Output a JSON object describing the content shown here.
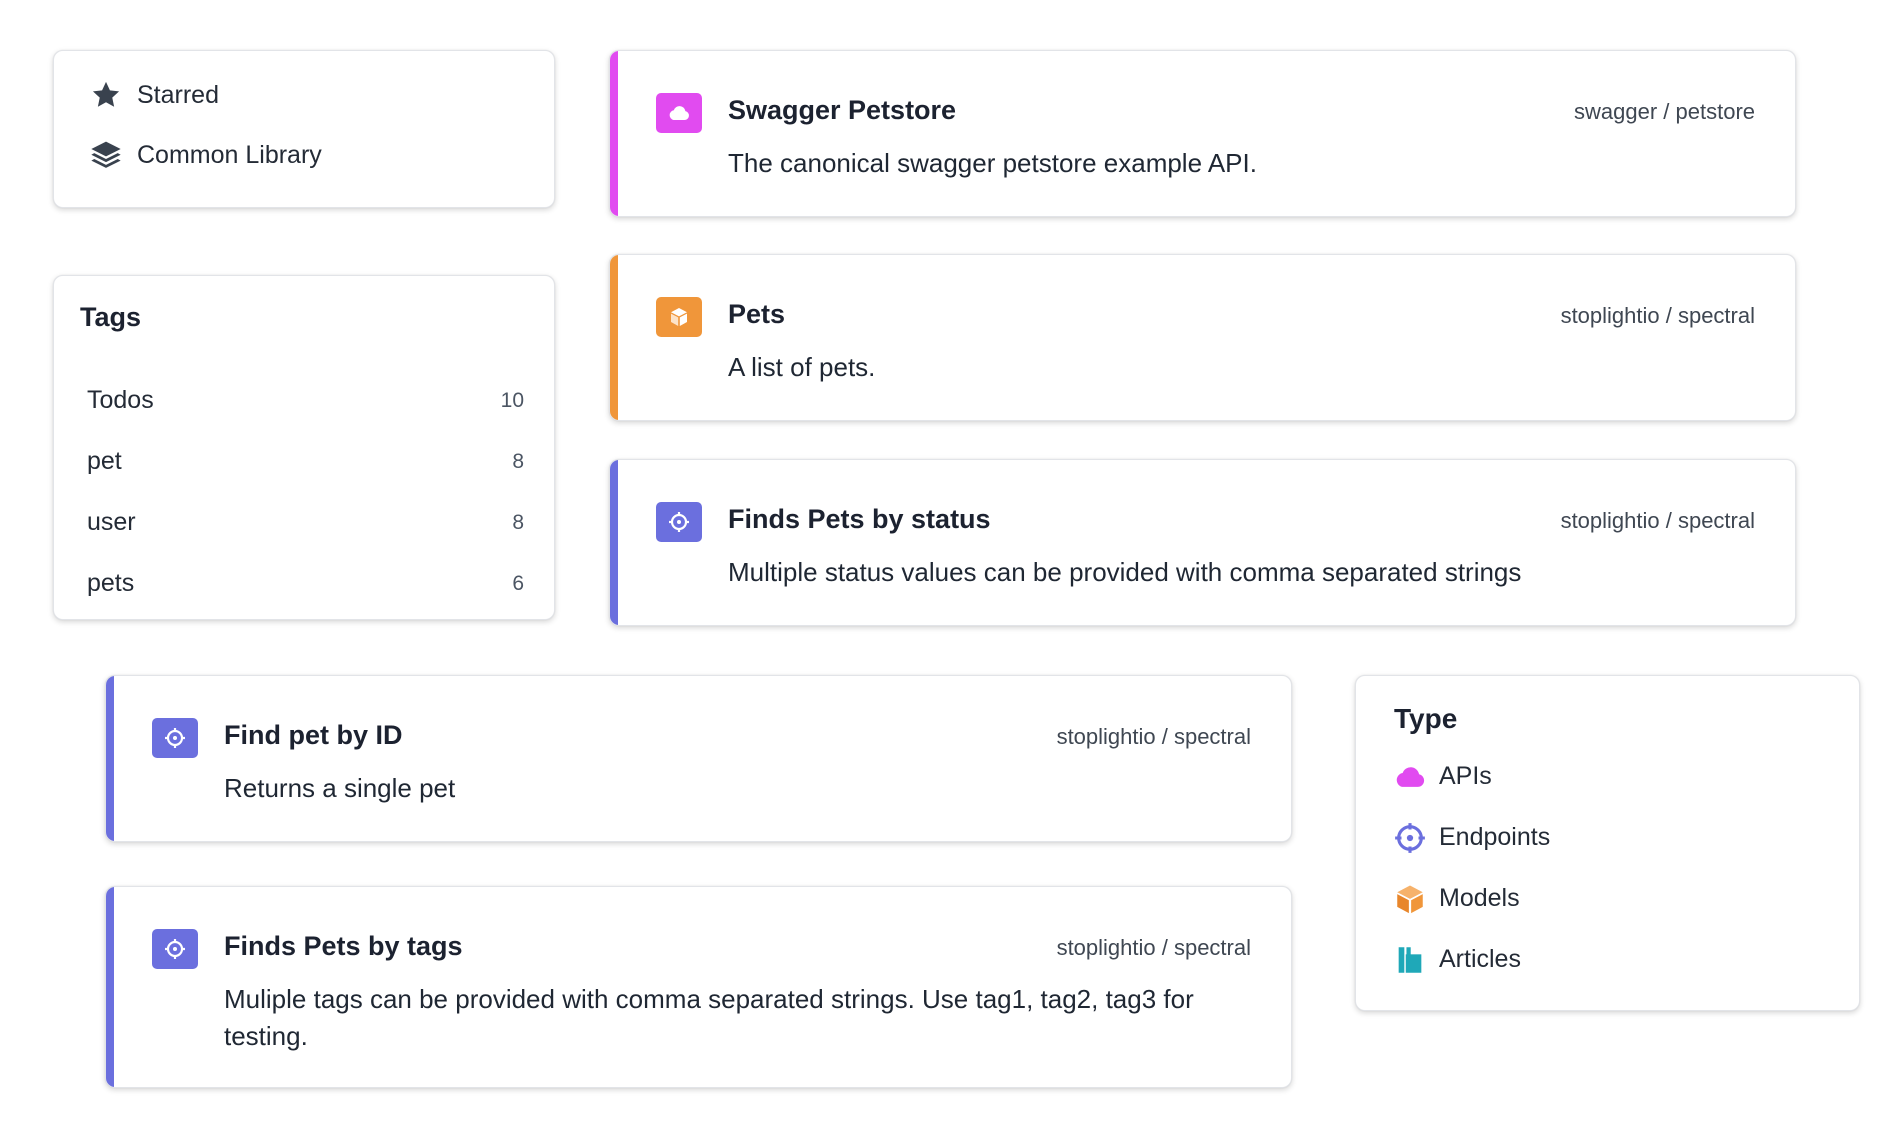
{
  "nav": {
    "items": [
      {
        "label": "Starred",
        "icon": "star-icon"
      },
      {
        "label": "Common Library",
        "icon": "layers-icon"
      }
    ]
  },
  "tags": {
    "title": "Tags",
    "items": [
      {
        "label": "Todos",
        "count": "10"
      },
      {
        "label": "pet",
        "count": "8"
      },
      {
        "label": "user",
        "count": "8"
      },
      {
        "label": "pets",
        "count": "6"
      }
    ]
  },
  "results": [
    {
      "title": "Swagger Petstore",
      "repo": "swagger / petstore",
      "description": "The canonical swagger petstore example API.",
      "kind": "api",
      "icon": "cloud-icon",
      "color": "#e14bf0"
    },
    {
      "title": "Pets",
      "repo": "stoplightio / spectral",
      "description": "A list of pets.",
      "kind": "model",
      "icon": "cube-icon",
      "color": "#f0963a"
    },
    {
      "title": "Finds Pets by status",
      "repo": "stoplightio / spectral",
      "description": "Multiple status values can be provided with comma separated strings",
      "kind": "endpoint",
      "icon": "crosshairs-icon",
      "color": "#6b6fde"
    },
    {
      "title": "Find pet by ID",
      "repo": "stoplightio / spectral",
      "description": "Returns a single pet",
      "kind": "endpoint",
      "icon": "crosshairs-icon",
      "color": "#6b6fde"
    },
    {
      "title": "Finds Pets by tags",
      "repo": "stoplightio / spectral",
      "description": "Muliple tags can be provided with comma separated strings. Use tag1, tag2, tag3 for testing.",
      "kind": "endpoint",
      "icon": "crosshairs-icon",
      "color": "#6b6fde"
    }
  ],
  "type_filter": {
    "title": "Type",
    "items": [
      {
        "label": "APIs",
        "icon": "cloud-icon",
        "color": "#e14bf0"
      },
      {
        "label": "Endpoints",
        "icon": "crosshairs-icon",
        "color": "#6b6fde"
      },
      {
        "label": "Models",
        "icon": "cube-icon",
        "color": "#f0963a"
      },
      {
        "label": "Articles",
        "icon": "book-icon",
        "color": "#1fa8b8"
      }
    ]
  }
}
